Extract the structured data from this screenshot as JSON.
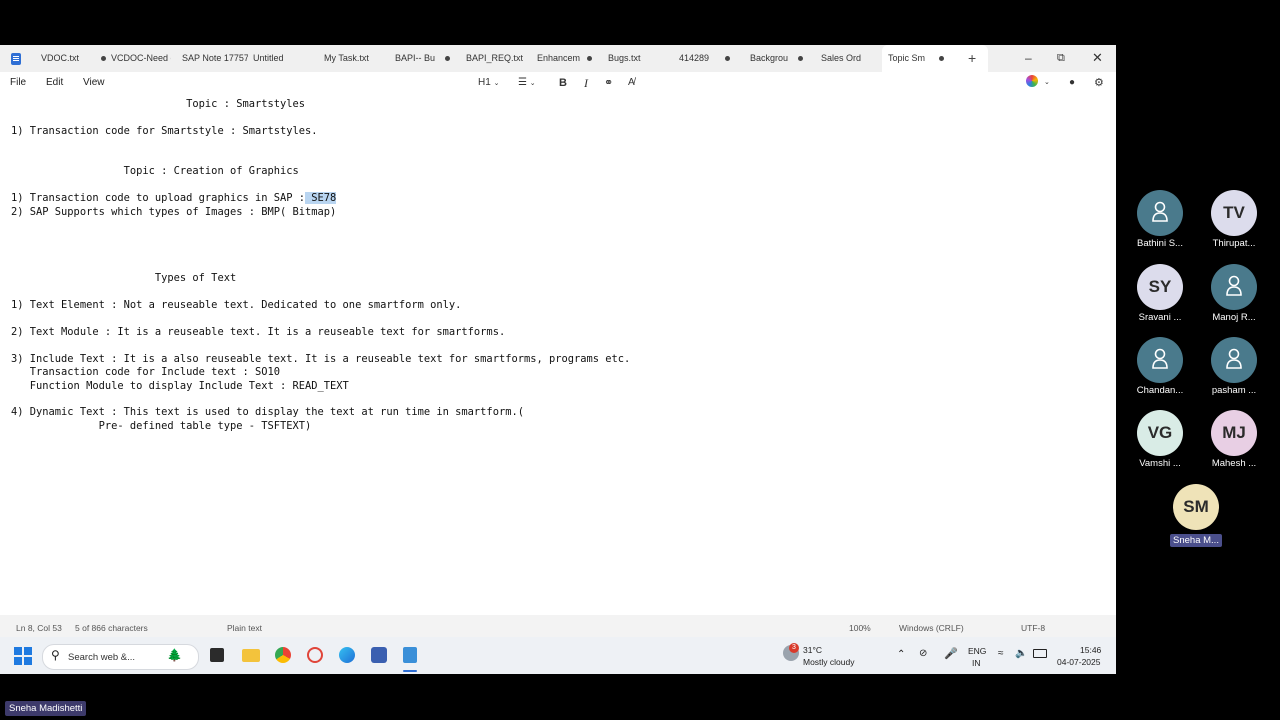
{
  "window": {
    "tabs": [
      {
        "label": "VDOC.txt",
        "active": false,
        "modified": true
      },
      {
        "label": "VCDOC-Need c",
        "active": false,
        "modified": false
      },
      {
        "label": "SAP Note 17757",
        "active": false,
        "modified": false
      },
      {
        "label": "Untitled",
        "active": false,
        "modified": false
      },
      {
        "label": "My Task.txt",
        "active": false,
        "modified": false
      },
      {
        "label": "BAPI-- Bu",
        "active": false,
        "modified": true
      },
      {
        "label": "BAPI_REQ.txt",
        "active": false,
        "modified": false
      },
      {
        "label": "Enhancem",
        "active": false,
        "modified": true
      },
      {
        "label": "Bugs.txt",
        "active": false,
        "modified": false
      },
      {
        "label": "414289",
        "active": false,
        "modified": true
      },
      {
        "label": "Backgrou",
        "active": false,
        "modified": true
      },
      {
        "label": "Sales Ord",
        "active": false,
        "modified": false
      },
      {
        "label": "Topic  Sm",
        "active": true,
        "modified": true
      }
    ],
    "menu": [
      "File",
      "Edit",
      "View"
    ],
    "toolbar": {
      "heading": "H1"
    }
  },
  "editor": {
    "lines": [
      {
        "text": "                            Topic : Smartstyles"
      },
      {
        "text": "1) Transaction code for Smartstyle : Smartstyles."
      },
      {
        "text": "                  Topic : Creation of Graphics"
      },
      {
        "text": "1) Transaction code to upload graphics in SAP :",
        "selected": " SE78"
      },
      {
        "text": "2) SAP Supports which types of Images : BMP( Bitmap)"
      },
      {
        "text": "                       Types of Text"
      },
      {
        "text": "1) Text Element : Not a reuseable text. Dedicated to one smartform only."
      },
      {
        "text": "2) Text Module : It is a reuseable text. It is a reuseable text for smartforms."
      },
      {
        "text": "3) Include Text : It is a also reuseable text. It is a reuseable text for smartforms, programs etc."
      },
      {
        "text": "   Transaction code for Include text : SO10"
      },
      {
        "text": "   Function Module to display Include Text : READ_TEXT"
      },
      {
        "text": "4) Dynamic Text : This text is used to display the text at run time in smartform.("
      },
      {
        "text": "              Pre- defined table type - TSFTEXT)"
      }
    ]
  },
  "status": {
    "position": "Ln 8, Col 53",
    "chars": "5 of 866 characters",
    "format": "Plain text",
    "zoom": "100%",
    "line_ending": "Windows (CRLF)",
    "encoding": "UTF-8"
  },
  "taskbar": {
    "search_placeholder": "Search web &...",
    "weather_temp": "31°C",
    "weather_desc": "Mostly cloudy",
    "weather_badge": "3",
    "lang_line1": "ENG",
    "lang_line2": "IN",
    "time": "15:46",
    "date": "04-07-2025"
  },
  "participants": [
    {
      "initials": "",
      "name": "Bathini S...",
      "color": "#4a7a8c",
      "icon": "person-icon"
    },
    {
      "initials": "TV",
      "name": "Thirupat...",
      "color": "#dcdcec"
    },
    {
      "initials": "SY",
      "name": "Sravani ...",
      "color": "#dcdcec"
    },
    {
      "initials": "",
      "name": "Manoj R...",
      "color": "#4a7a8c",
      "icon": "person-icon"
    },
    {
      "initials": "",
      "name": "Chandan...",
      "color": "#4a7a8c",
      "icon": "person-icon"
    },
    {
      "initials": "",
      "name": "pasham ...",
      "color": "#4a7a8c",
      "icon": "person-icon"
    },
    {
      "initials": "VG",
      "name": "Vamshi ...",
      "color": "#d9ece6"
    },
    {
      "initials": "MJ",
      "name": "Mahesh ...",
      "color": "#e8cfe4"
    },
    {
      "initials": "SM",
      "name": "Sneha M...",
      "color": "#efe3b8",
      "highlight": true
    }
  ],
  "presenter": "Sneha Madishetti"
}
